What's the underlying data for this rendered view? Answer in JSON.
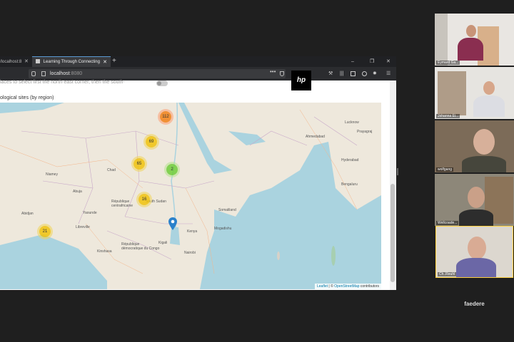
{
  "browser": {
    "tabs": [
      {
        "label": "/localhost:8",
        "close": "✕"
      },
      {
        "label": "Learning Through Connecting",
        "close": "✕"
      }
    ],
    "new_tab": "+",
    "window_controls": {
      "minimize": "–",
      "maximize": "❐",
      "close": "✕"
    },
    "url": {
      "host": "localhost",
      "port": ":8080"
    },
    "toolbar_icons": [
      "more-icon",
      "shield-icon",
      "star-icon",
      "hp-icon",
      "wrench-icon",
      "library-icon",
      "sidebar-icon",
      "account-icon",
      "extension-icon",
      "menu-icon"
    ]
  },
  "hp_logo": "hp",
  "page": {
    "instruction": "laces to select first the north-east corner, then the south-",
    "section_title": "ological sites (by region)"
  },
  "map": {
    "clusters": [
      {
        "count": "112",
        "color": "o"
      },
      {
        "count": "69",
        "color": "y"
      },
      {
        "count": "65",
        "color": "y"
      },
      {
        "count": "2",
        "color": "g"
      },
      {
        "count": "16",
        "color": "y"
      },
      {
        "count": "21",
        "color": "y"
      }
    ],
    "places": [
      "Lucknow",
      "Prayagraj",
      "Ahmedabad",
      "Hyderabad",
      "Bengaluru",
      "Chad",
      "Niamey",
      "Abuja",
      "Yaounde",
      "Libreville",
      "Kinshasa",
      "Kigali",
      "Kenya",
      "Mogadishu",
      "South Sudan",
      "République centrafricaine",
      "République démocratique du Congo",
      "Somaliland",
      "Nairobi",
      "Abidjan"
    ],
    "attribution": {
      "leaflet": "Leaflet",
      "sep": " | © ",
      "osm": "OpenStreetMap",
      "tail": " contributors"
    }
  },
  "participants": [
    {
      "name": "Eymard Ga..."
    },
    {
      "name": "Johanna Ei..."
    },
    {
      "name": "wolfgang"
    },
    {
      "name": "Wellcoade..."
    },
    {
      "name": "Ch..Reuhl"
    }
  ],
  "caption": "faedere",
  "colors": {
    "cluster_yellow": "#f0c20c",
    "cluster_green": "#6ecc39",
    "cluster_orange": "#f18017",
    "speaker_border": "#ffd23f"
  }
}
